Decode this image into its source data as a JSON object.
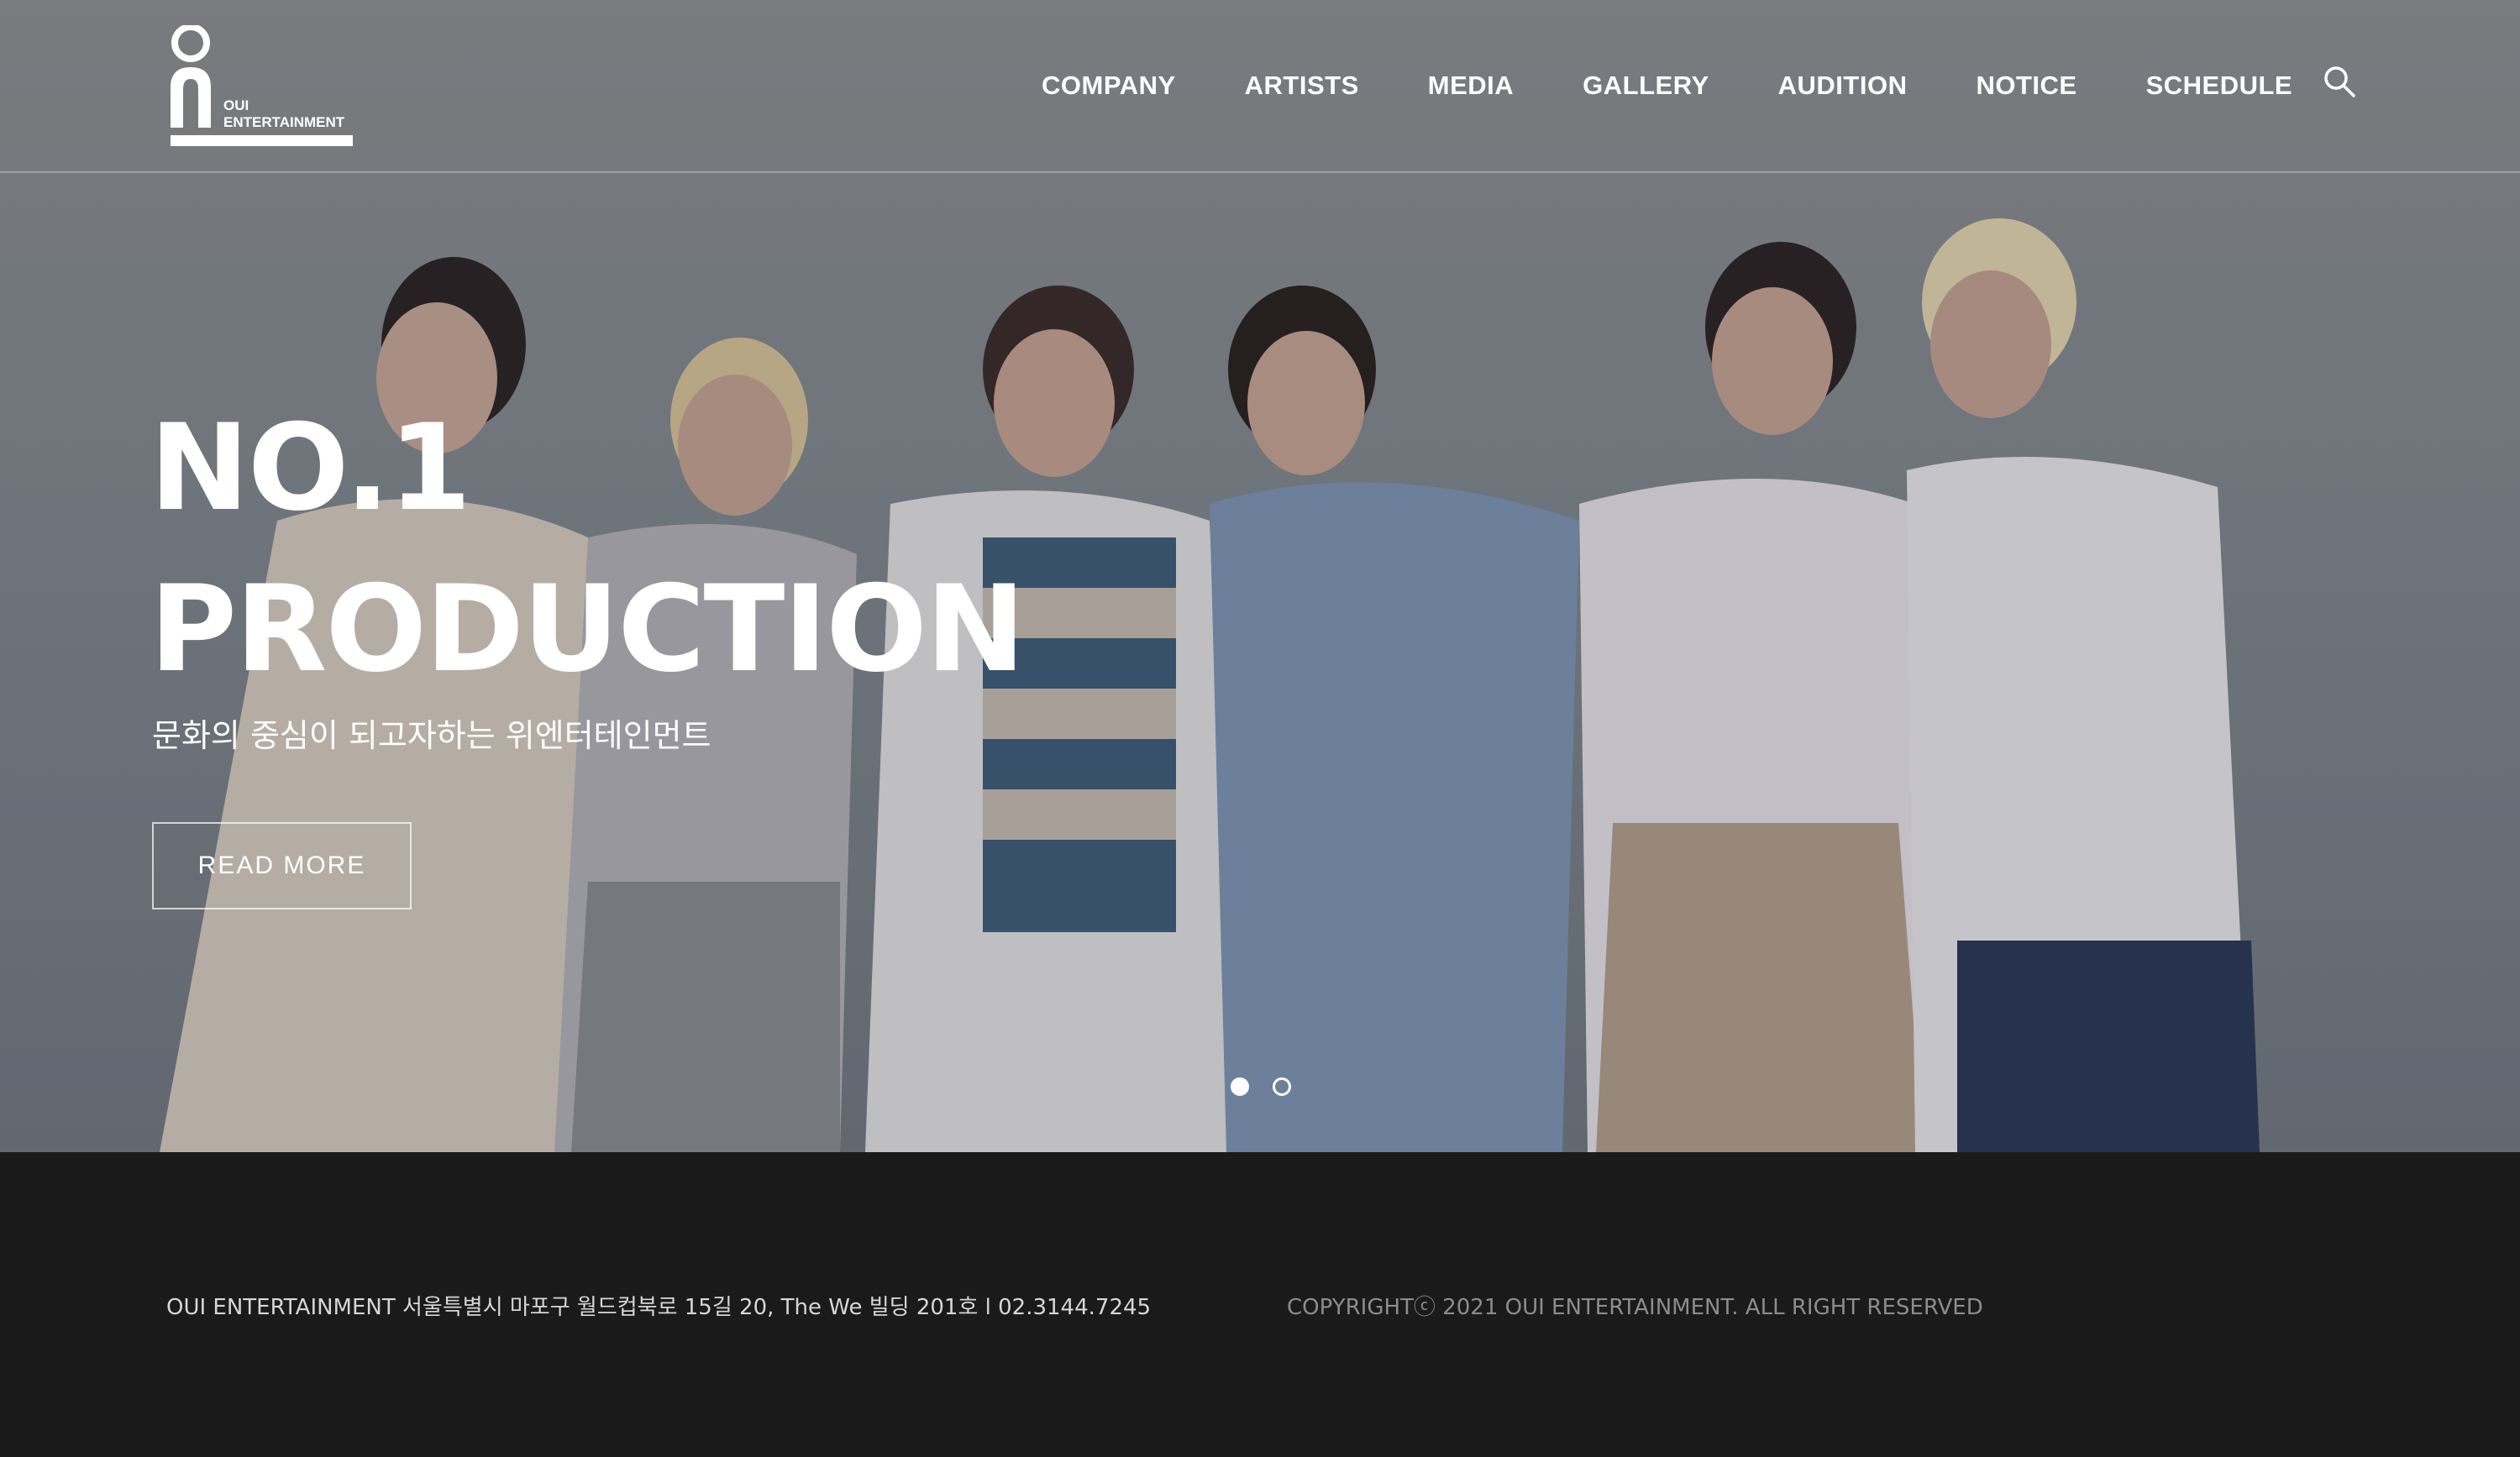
{
  "brand": {
    "logo_line1": "OUI",
    "logo_line2": "ENTERTAINMENT"
  },
  "nav": {
    "items": [
      {
        "label": "COMPANY"
      },
      {
        "label": "ARTISTS"
      },
      {
        "label": "MEDIA"
      },
      {
        "label": "GALLERY"
      },
      {
        "label": "AUDITION"
      },
      {
        "label": "NOTICE"
      },
      {
        "label": "SCHEDULE"
      }
    ],
    "search_icon": "search-icon"
  },
  "hero": {
    "headline_line1": "NO.1",
    "headline_line2": "PRODUCTION",
    "subtitle": "문화의 중심이 되고자하는 위엔터테인먼트",
    "cta_label": "READ MORE",
    "slides_total": 2,
    "active_slide": 1
  },
  "footer": {
    "address": "OUI ENTERTAINMENT 서울특별시 마포구 월드컵북로 15길 20, The We 빌딩 201호 l 02.3144.7245",
    "copyright": "COPYRIGHTⓒ 2021 OUI ENTERTAINMENT. ALL RIGHT RESERVED"
  },
  "colors": {
    "header_text": "#ffffff",
    "footer_bg": "#1b1a1a",
    "footer_text": "#d6d6d6",
    "footer_copy": "#8c8c8c"
  }
}
